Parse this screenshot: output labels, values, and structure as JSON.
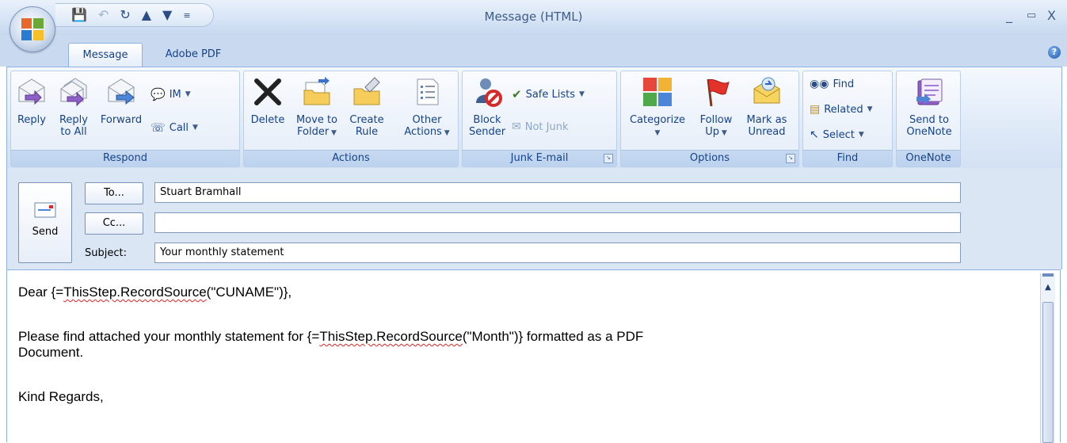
{
  "window": {
    "title": "Message (HTML)",
    "minimize": "_",
    "maximize": "▭",
    "close": "X"
  },
  "tabs": [
    {
      "label": "Message"
    },
    {
      "label": "Adobe PDF"
    }
  ],
  "ribbon": {
    "respond": {
      "label": "Respond",
      "reply": "Reply",
      "reply_all_1": "Reply",
      "reply_all_2": "to All",
      "forward": "Forward",
      "im": "IM",
      "call": "Call"
    },
    "actions": {
      "label": "Actions",
      "delete": "Delete",
      "move_1": "Move to",
      "move_2": "Folder",
      "rule_1": "Create",
      "rule_2": "Rule",
      "other_1": "Other",
      "other_2": "Actions"
    },
    "junk": {
      "label": "Junk E-mail",
      "block_1": "Block",
      "block_2": "Sender",
      "safe_lists": "Safe Lists",
      "not_junk": "Not Junk"
    },
    "options": {
      "label": "Options",
      "categorize": "Categorize",
      "follow_1": "Follow",
      "follow_2": "Up",
      "mark_1": "Mark as",
      "mark_2": "Unread"
    },
    "find": {
      "label": "Find",
      "find": "Find",
      "related": "Related",
      "select": "Select"
    },
    "onenote": {
      "label": "OneNote",
      "send_1": "Send to",
      "send_2": "OneNote"
    }
  },
  "header": {
    "send": "Send",
    "to_button": "To...",
    "cc_button": "Cc...",
    "subject_label": "Subject:",
    "to_value": "Stuart Bramhall",
    "cc_value": "",
    "subject_value": "Your monthly statement"
  },
  "body": {
    "line1_a": "Dear {=",
    "line1_b": "ThisStep.RecordSource",
    "line1_c": "(\"CUNAME\")},",
    "line2_a": "Please find attached your monthly statement for {=",
    "line2_b": "ThisStep.RecordSource",
    "line2_c": "(\"Month\")} formatted as a PDF",
    "line3": "Document.",
    "line4": "Kind Regards,"
  },
  "colors": {
    "ribbon_text": "#15428b",
    "accent_red": "#e32424"
  }
}
